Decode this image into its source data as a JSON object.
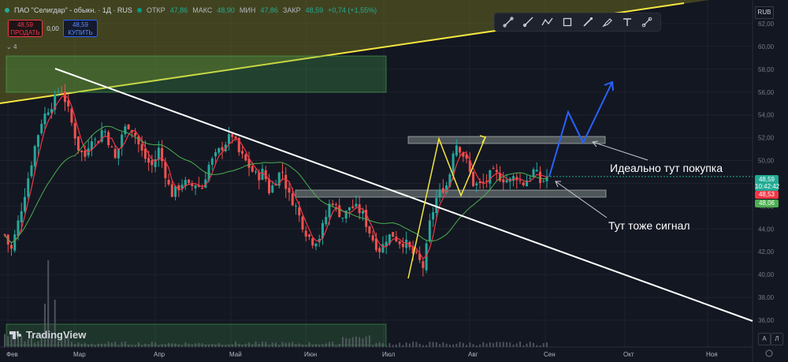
{
  "header": {
    "title": "ПАО \"Селигдар\" - обыкн. · 1Д · RUS",
    "open_label": "ОТКР",
    "open": "47,86",
    "high_label": "МАКС",
    "high": "48,90",
    "low_label": "МИН",
    "low": "47,86",
    "close_label": "ЗАКР",
    "close": "48,59",
    "change": "+0,74 (+1,55%)"
  },
  "trade": {
    "sell_price": "48,59",
    "sell_label": "ПРОДАТЬ",
    "spread": "0,00",
    "buy_price": "48,59",
    "buy_label": "КУПИТЬ"
  },
  "indicators_count": "4",
  "currency": "RUB",
  "price_axis": [
    "62,00",
    "60,00",
    "58,00",
    "56,00",
    "54,00",
    "52,00",
    "50,00",
    "48,00",
    "46,00",
    "44,00",
    "42,00",
    "40,00",
    "38,00",
    "36,00"
  ],
  "price_tags": {
    "last": "48,59",
    "countdown": "10:42:42",
    "ma1": "48,53",
    "ma2": "48,06",
    "colors": {
      "last": "#22ab94",
      "ma1": "#f23645",
      "ma2": "#4caf50"
    }
  },
  "time_axis": [
    "Фев",
    "Мар",
    "Апр",
    "Май",
    "Июн",
    "Июл",
    "Авг",
    "Сен",
    "Окт",
    "Ноя"
  ],
  "annotations": {
    "buy_note": "Идеально тут покупка",
    "signal_note": "Тут тоже сигнал"
  },
  "toolbar_icons": [
    "line-tool-icon",
    "ray-tool-icon",
    "path-tool-icon",
    "rectangle-tool-icon",
    "brush-tool-icon",
    "highlighter-tool-icon",
    "text-tool-icon",
    "measure-tool-icon"
  ],
  "logo_text": "TradingView",
  "buttons": {
    "auto": "A",
    "log": "Л"
  },
  "chart_data": {
    "type": "candlestick",
    "ylim": [
      35.5,
      62.8
    ],
    "x_labels": [
      "Фев",
      "Мар",
      "Апр",
      "Май",
      "Июн",
      "Июл",
      "Авг",
      "Сен",
      "Окт",
      "Ноя"
    ],
    "close_path": [
      43.5,
      42.0,
      44.2,
      46.5,
      49.0,
      51.5,
      53.5,
      54.5,
      55.2,
      56.5,
      55.0,
      53.0,
      51.0,
      50.3,
      52.2,
      51.5,
      53.0,
      51.5,
      50.0,
      52.3,
      53.2,
      52.5,
      51.0,
      50.0,
      49.5,
      51.0,
      49.0,
      47.0,
      47.5,
      48.2,
      47.6,
      48.0,
      47.5,
      49.5,
      50.2,
      51.0,
      51.7,
      52.3,
      50.7,
      50.0,
      49.2,
      48.5,
      49.1,
      47.2,
      48.4,
      49.2,
      47.0,
      46.3,
      44.8,
      43.6,
      42.9,
      43.2,
      44.8,
      46.7,
      45.6,
      45.0,
      46.0,
      45.8,
      45.4,
      44.0,
      42.8,
      42.1,
      43.3,
      43.5,
      42.9,
      42.8,
      42.0,
      41.4,
      40.6,
      44.5,
      46.6,
      47.5,
      48.0,
      51.7,
      51.0,
      49.8,
      48.0,
      47.8,
      48.1,
      48.9,
      48.7,
      48.4,
      48.2,
      48.7,
      47.9,
      48.5,
      49.2,
      48.0,
      48.6
    ],
    "overlays": [
      "descending trendline",
      "ascending support line",
      "two horizontal zones",
      "green rectangles",
      "yellow zigzag",
      "blue projected path"
    ]
  }
}
